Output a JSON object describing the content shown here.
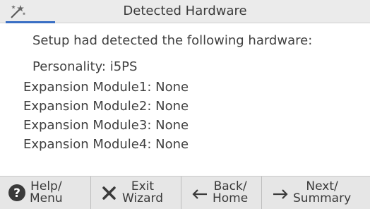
{
  "window": {
    "title": "Detected Hardware",
    "icon": "wizard-icon"
  },
  "content": {
    "intro": "Setup had detected the following hardware:",
    "personality": "Personality: i5PS",
    "modules": [
      "Expansion Module1: None",
      "Expansion Module2: None",
      "Expansion Module3: None",
      "Expansion Module4: None"
    ]
  },
  "footer": {
    "help": {
      "line1": "Help/",
      "line2": "Menu",
      "icon": "question-circle-icon"
    },
    "exit": {
      "line1": "Exit",
      "line2": "Wizard",
      "icon": "close-x-icon"
    },
    "back": {
      "line1": "Back/",
      "line2": "Home",
      "icon": "arrow-left-icon"
    },
    "next": {
      "line1": "Next/",
      "line2": "Summary",
      "icon": "arrow-right-icon"
    }
  },
  "colors": {
    "titlebar": "#ebebeb",
    "accent": "#3a6fc4",
    "footer": "#e6e6e6",
    "text": "#3a3a3a"
  }
}
